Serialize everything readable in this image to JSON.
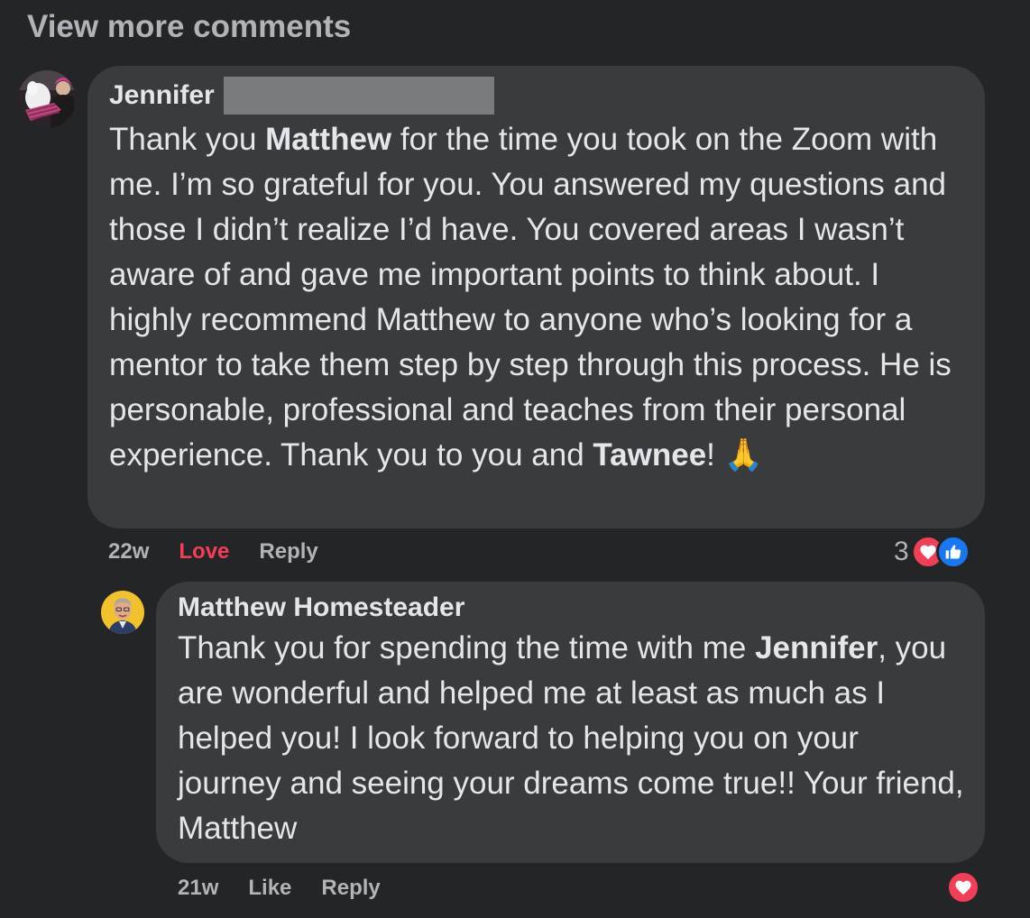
{
  "thread": {
    "view_more_label": "View more comments"
  },
  "comment1": {
    "author": "Jennifer",
    "text_parts": {
      "p1": "Thank you ",
      "b1": "Matthew",
      "p2": " for the time you took on the Zoom with me. I’m so grateful for you. You answered my questions and those I didn’t realize I’d have. You covered areas I wasn’t aware of and gave me important points to think about. I highly recommend Matthew to anyone who’s looking for a mentor to take them step by step through this process. He is personable, professional and teaches from their personal experience. Thank you to you and ",
      "b2": "Tawnee",
      "p3": "! ",
      "emoji": "🙏"
    },
    "time": "22w",
    "reaction_label": "Love",
    "reply_label": "Reply",
    "reaction_count": "3",
    "reaction_icons": [
      "heart-icon",
      "thumbs-up-icon"
    ],
    "colors": {
      "love": "#f33e58",
      "like": "#1877f2"
    }
  },
  "comment2": {
    "author": "Matthew Homesteader",
    "text_parts": {
      "p1": "Thank you for spending the time with me ",
      "b1": "Jennifer",
      "p2": ", you are wonderful and helped me at least as much as I helped you! I look forward to helping you on your journey and seeing your dreams come true!! Your friend, Matthew"
    },
    "time": "21w",
    "reaction_label": "Like",
    "reply_label": "Reply",
    "reaction_icons": [
      "heart-icon"
    ]
  }
}
